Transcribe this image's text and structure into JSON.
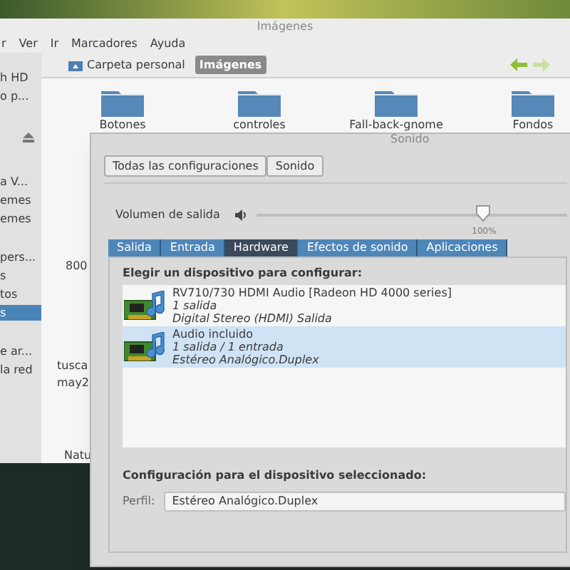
{
  "file_manager": {
    "title": "Imágenes",
    "menu": [
      "r",
      "Ver",
      "Ir",
      "Marcadores",
      "Ayuda"
    ],
    "sidebar": [
      {
        "label": "h HD",
        "selected": false
      },
      {
        "label": "o p...",
        "selected": false
      },
      {
        "label": "a V...",
        "selected": false
      },
      {
        "label": "emes",
        "selected": false
      },
      {
        "label": "emes",
        "selected": false
      },
      {
        "label": "pers...",
        "selected": false
      },
      {
        "label": "s",
        "selected": false
      },
      {
        "label": "tos",
        "selected": false
      },
      {
        "label": "s",
        "selected": true
      },
      {
        "label": "e ar...",
        "selected": false
      },
      {
        "label": "la red",
        "selected": false
      }
    ],
    "path": [
      {
        "label": "Carpeta personal",
        "selected": false
      },
      {
        "label": "Imágenes",
        "selected": true
      }
    ],
    "folders": [
      "Botones",
      "controles",
      "Fall-back-gnome",
      "Fondos"
    ],
    "files": [
      "800",
      "tusca",
      "may2",
      "Natu"
    ]
  },
  "sound": {
    "title": "Sonido",
    "buttons": [
      "Todas las configuraciones",
      "Sonido"
    ],
    "volume": {
      "label": "Volumen de salida",
      "level": 0.73,
      "reading": "100%"
    },
    "tabs": [
      {
        "label": "Salida",
        "selected": false
      },
      {
        "label": "Entrada",
        "selected": false
      },
      {
        "label": "Hardware",
        "selected": true
      },
      {
        "label": "Efectos de sonido",
        "selected": false
      },
      {
        "label": "Aplicaciones",
        "selected": false
      }
    ],
    "device_heading": "Elegir un dispositivo para configurar:",
    "devices": [
      {
        "name": "RV710/730 HDMI Audio [Radeon HD 4000 series]",
        "channels": "1 salida",
        "profile": "Digital Stereo (HDMI) Salida",
        "selected": false
      },
      {
        "name": "Audio incluido",
        "channels": "1 salida / 1 entrada",
        "profile": "Estéreo Analógico.Duplex",
        "selected": true
      }
    ],
    "config_heading": "Configuración para el dispositivo seleccionado:",
    "profile_label": "Perfil:",
    "profile_value": "Estéreo Analógico.Duplex"
  }
}
